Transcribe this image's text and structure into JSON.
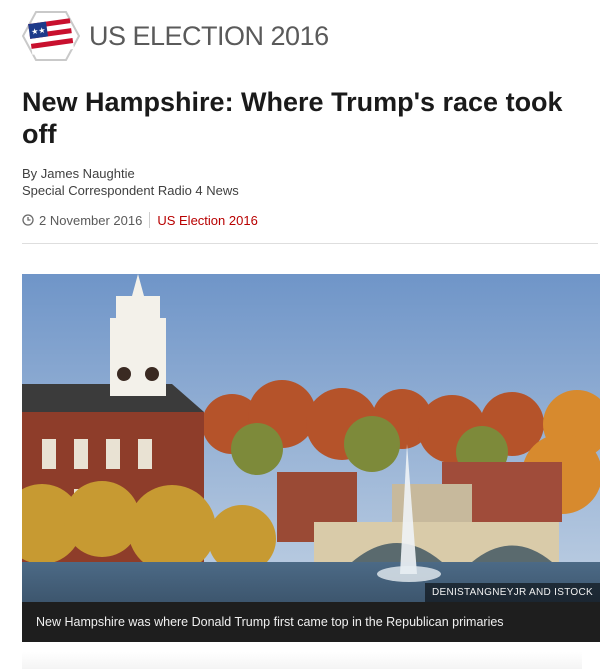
{
  "banner": {
    "title": "US ELECTION 2016"
  },
  "article": {
    "headline": "New Hampshire: Where Trump's race took off",
    "byline": {
      "author": "By James Naughtie",
      "role": "Special Correspondent Radio 4 News"
    },
    "date": "2 November 2016",
    "topic": "US Election 2016"
  },
  "media": {
    "credit": "DENISTANGNEYJR AND ISTOCK",
    "caption": "New Hampshire was where Donald Trump first came top in the Republican primaries"
  },
  "icons": {
    "logo": "us-flag-hexagon-icon",
    "date": "clock-icon"
  },
  "colors": {
    "accent": "#b80000",
    "flag_red": "#c8102e",
    "flag_blue": "#1d3a8a"
  }
}
